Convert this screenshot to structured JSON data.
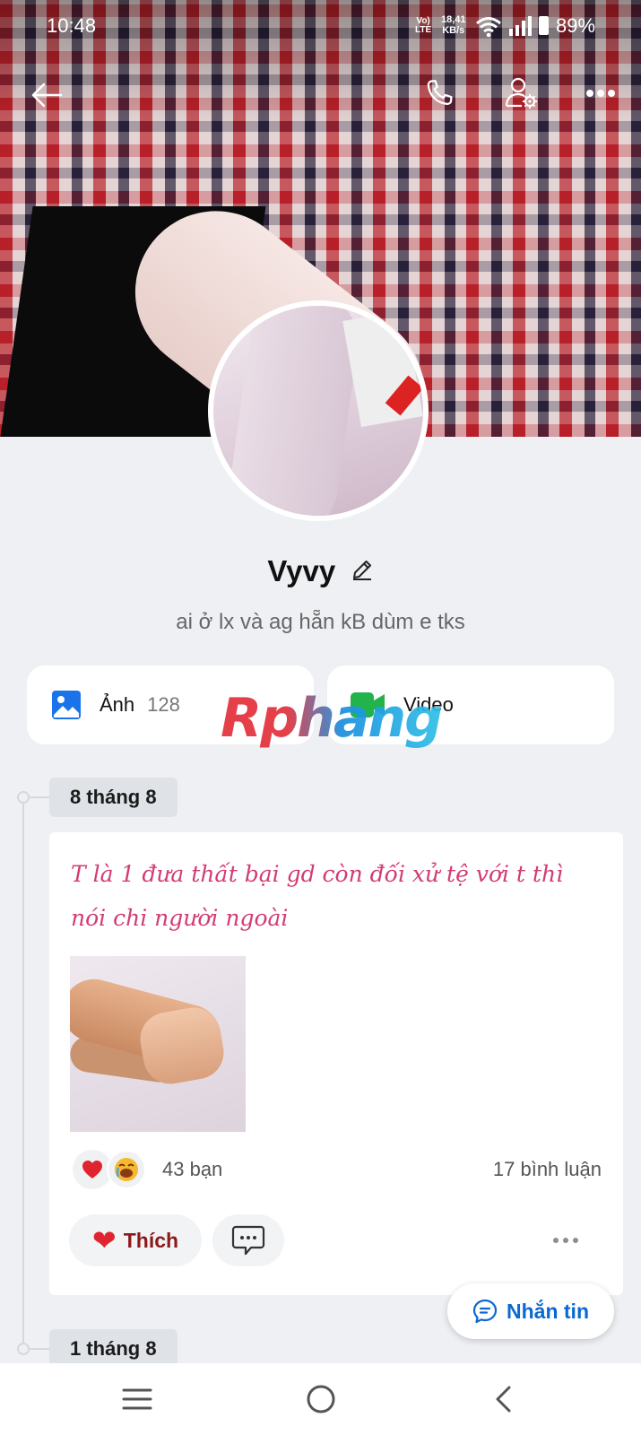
{
  "status_bar": {
    "time": "10:48",
    "network_top": "Vo)",
    "network_bottom": "LTE",
    "speed_value": "18,41",
    "speed_unit": "KB/s",
    "battery": "89%"
  },
  "header": {
    "back_icon": "arrow-left-icon",
    "call_icon": "phone-icon",
    "settings_icon": "user-settings-icon",
    "more_icon": "more-horizontal-icon"
  },
  "profile": {
    "name": "Vyvy",
    "bio": "ai ở lx và ag hẵn kB dùm e tks"
  },
  "media": {
    "photos_label": "Ảnh",
    "photos_count": "128",
    "video_label": "Video"
  },
  "watermark": "Rphang",
  "timeline": {
    "dates": [
      "8 tháng 8",
      "1 tháng 8"
    ]
  },
  "post": {
    "text": "T là 1 đưa thất bại gd còn đối xử tệ với t thì nói chi người ngoài",
    "reactions_count": "43 bạn",
    "comments_count": "17 bình luận",
    "like_label": "Thích"
  },
  "message_button": "Nhắn tin",
  "colors": {
    "accent_blue": "#0a68d1",
    "post_text": "#d23c74",
    "like_red": "#e0242f",
    "photos_icon": "#1a73e8",
    "video_icon": "#22b34a"
  }
}
